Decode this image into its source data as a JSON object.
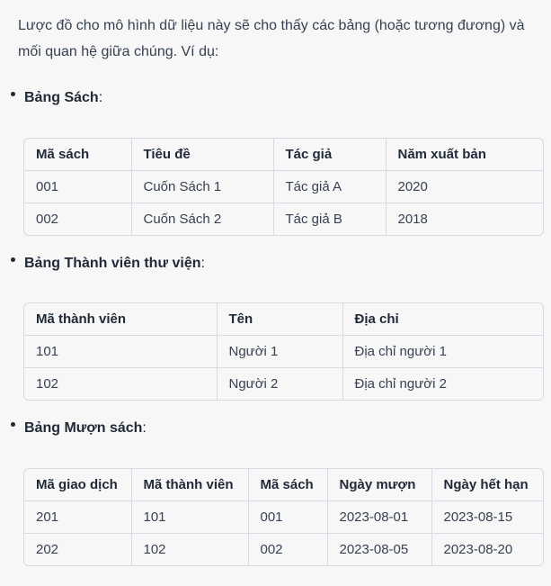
{
  "intro": "Lược đồ cho mô hình dữ liệu này sẽ cho thấy các bảng (hoặc tương đương) và mối quan hệ giữa chúng. Ví dụ:",
  "sections": [
    {
      "title": "Bảng Sách",
      "suffix": ":",
      "headers": [
        "Mã sách",
        "Tiêu đề",
        "Tác giả",
        "Năm xuất bản"
      ],
      "rows": [
        [
          "001",
          "Cuốn Sách 1",
          "Tác giả A",
          "2020"
        ],
        [
          "002",
          "Cuốn Sách 2",
          "Tác giả B",
          "2018"
        ]
      ]
    },
    {
      "title": "Bảng Thành viên thư viện",
      "suffix": ":",
      "headers": [
        "Mã thành viên",
        "Tên",
        "Địa chỉ"
      ],
      "rows": [
        [
          "101",
          "Người 1",
          "Địa chỉ người 1"
        ],
        [
          "102",
          "Người 2",
          "Địa chỉ người 2"
        ]
      ]
    },
    {
      "title": "Bảng Mượn sách",
      "suffix": ":",
      "headers": [
        "Mã giao dịch",
        "Mã thành viên",
        "Mã sách",
        "Ngày mượn",
        "Ngày hết hạn"
      ],
      "rows": [
        [
          "201",
          "101",
          "001",
          "2023-08-01",
          "2023-08-15"
        ],
        [
          "202",
          "102",
          "002",
          "2023-08-05",
          "2023-08-20"
        ]
      ]
    }
  ]
}
